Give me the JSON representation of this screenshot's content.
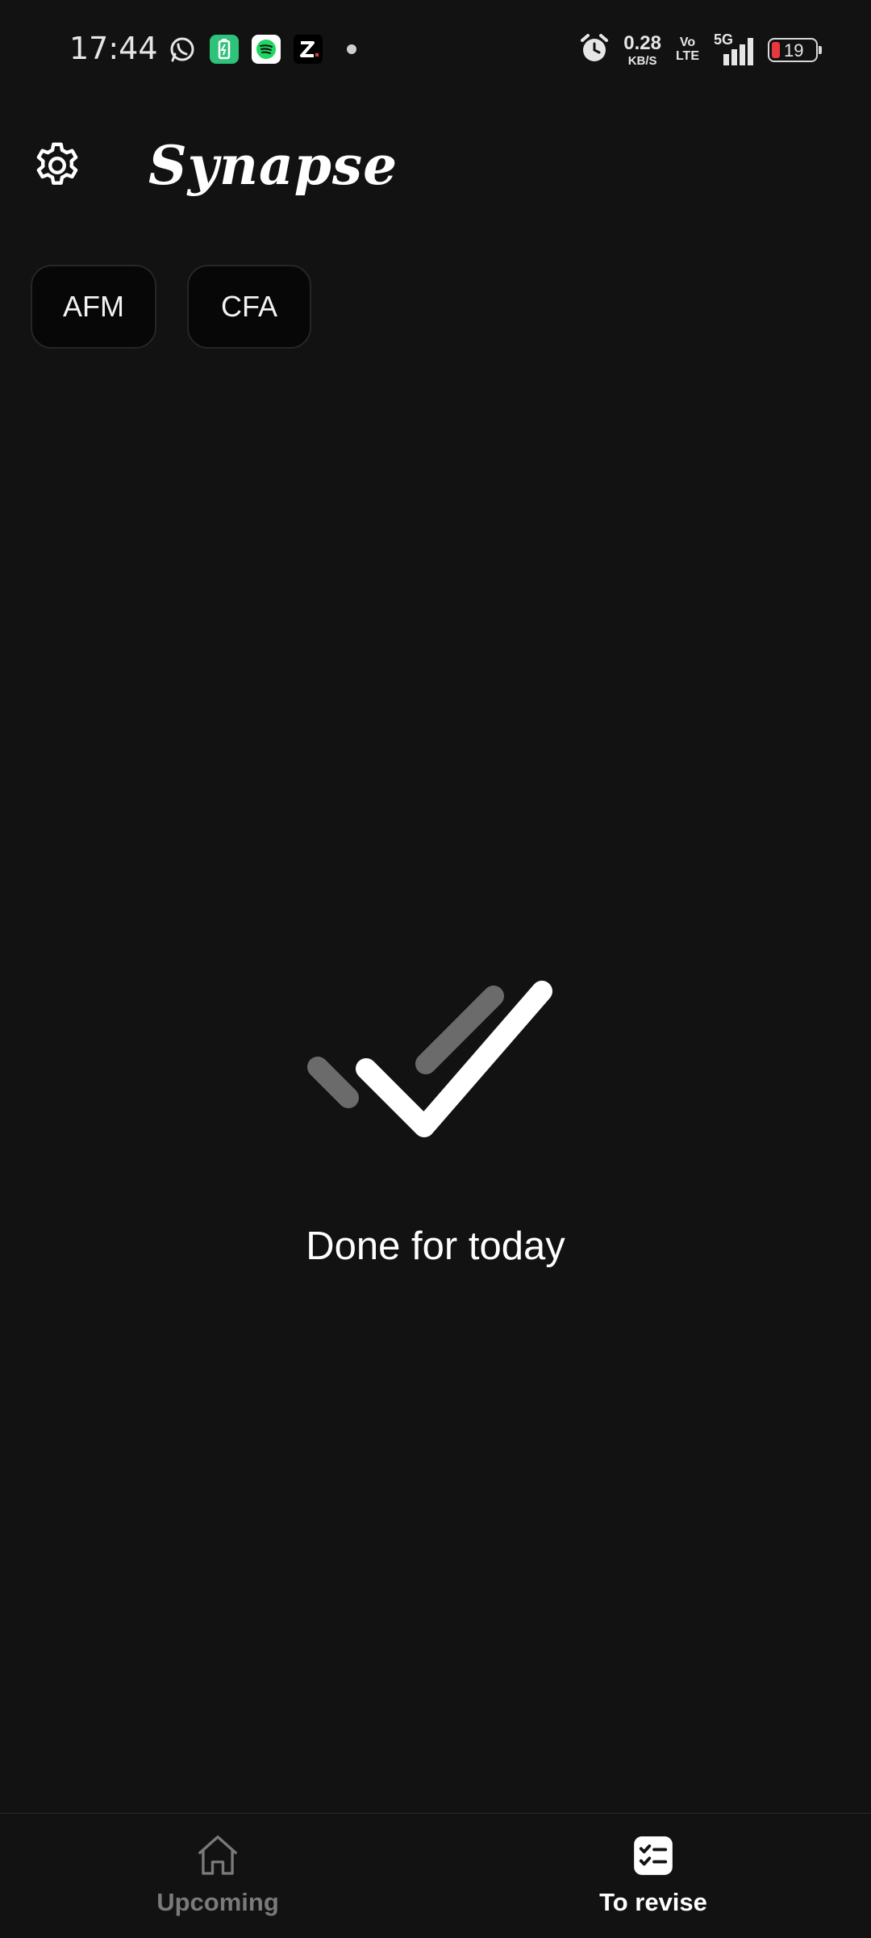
{
  "status_bar": {
    "time": "17:44",
    "notification_icons": [
      "whatsapp-icon",
      "battery-saver-icon",
      "spotify-icon",
      "zomato-icon",
      "more-dot-icon"
    ],
    "net_speed_value": "0.28",
    "net_speed_unit": "KB/S",
    "volte_top": "Vo",
    "volte_bottom": "LTE",
    "network": "5G",
    "battery_level": "19",
    "colors": {
      "battery_low": "#e8383d"
    }
  },
  "header": {
    "title": "Synapse",
    "settings_icon": "gear-icon"
  },
  "chips": [
    {
      "label": "AFM"
    },
    {
      "label": "CFA"
    }
  ],
  "empty_state": {
    "icon": "double-check-icon",
    "message": "Done for today"
  },
  "bottom_nav": {
    "items": [
      {
        "label": "Upcoming",
        "icon": "home-icon",
        "active": false
      },
      {
        "label": "To revise",
        "icon": "checklist-icon",
        "active": true
      }
    ]
  },
  "colors": {
    "background": "#121212",
    "chip_background": "#070707",
    "inactive": "#7a7a7a",
    "active": "#ffffff"
  }
}
